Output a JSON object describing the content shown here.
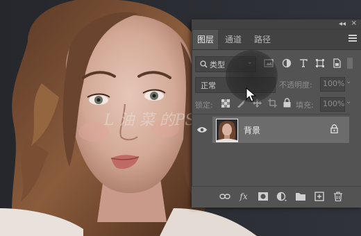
{
  "panel": {
    "collapse_glyph": "◂◂",
    "close_glyph": "×",
    "tabs": [
      {
        "label": "图层",
        "active": true
      },
      {
        "label": "通道",
        "active": false
      },
      {
        "label": "路径",
        "active": false
      }
    ],
    "menu_icon": "hamburger-icon"
  },
  "filter": {
    "kind_label": "类型",
    "icons": [
      "image-filter-icon",
      "adjustment-filter-icon",
      "type-filter-icon",
      "shape-filter-icon",
      "smart-object-filter-icon"
    ]
  },
  "blend": {
    "mode": "正常",
    "opacity_label": "不透明度:",
    "opacity_value": "100%"
  },
  "lock": {
    "label": "锁定:",
    "fill_label": "填充:",
    "fill_value": "100%"
  },
  "layers": [
    {
      "name": "背景",
      "visible": true,
      "locked": true,
      "selected": true
    }
  ],
  "bottom_icons": [
    "link-icon",
    "fx-icon",
    "mask-icon",
    "adjustment-icon",
    "folder-icon",
    "new-layer-icon",
    "trash-icon"
  ],
  "bottom_labels": {
    "fx": "fx"
  },
  "watermark": "L 油 菜 的PS 设 计",
  "colors": {
    "panel_bg": "#535353",
    "tab_bar": "#424242",
    "selected_layer": "#6c6c6c"
  }
}
